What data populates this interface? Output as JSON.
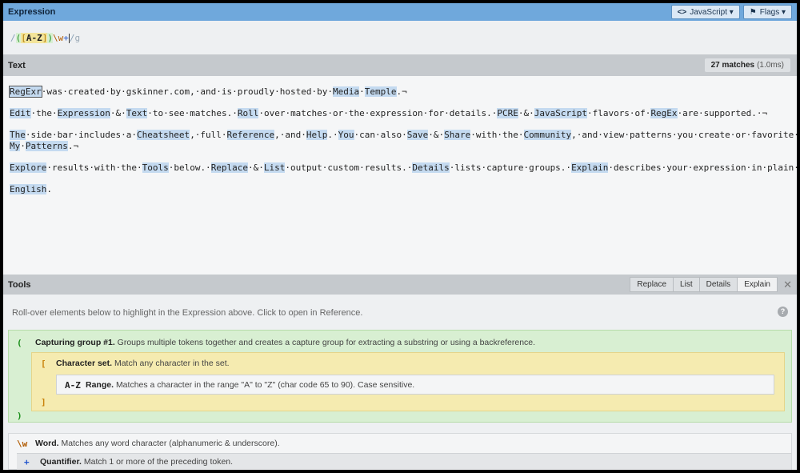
{
  "expression": {
    "title": "Expression",
    "flavor_button": "JavaScript ▾",
    "flavor_icon": "<>",
    "flags_button": "Flags ▾",
    "flags_icon": "⚑",
    "tokens": {
      "open_delim": "/",
      "group_open": "(",
      "set_open": "[",
      "range": "A-Z",
      "set_close": "]",
      "group_close": ")",
      "word": "\\w",
      "quant": "+",
      "close_delim": "/",
      "flags": "g"
    }
  },
  "text_panel": {
    "title": "Text",
    "match_count": "27 matches",
    "match_time": "(1.0ms)",
    "paragraphs": [
      [
        {
          "t": "RegExr",
          "m": true,
          "first": true
        },
        {
          "t": "·was·created·by·gskinner.com,·and·is·proudly·hosted·by·"
        },
        {
          "t": "Media",
          "m": true
        },
        {
          "t": "·"
        },
        {
          "t": "Temple",
          "m": true
        },
        {
          "t": ".¬"
        }
      ],
      [
        {
          "t": "Edit",
          "m": true
        },
        {
          "t": "·the·"
        },
        {
          "t": "Expression",
          "m": true
        },
        {
          "t": "·&·"
        },
        {
          "t": "Text",
          "m": true
        },
        {
          "t": "·to·see·matches.·"
        },
        {
          "t": "Roll",
          "m": true
        },
        {
          "t": "·over·matches·or·the·expression·for·details.·"
        },
        {
          "t": "PCRE",
          "m": true
        },
        {
          "t": "·&·"
        },
        {
          "t": "JavaScript",
          "m": true
        },
        {
          "t": "·flavors·of·"
        },
        {
          "t": "RegEx",
          "m": true
        },
        {
          "t": "·are·supported.·¬"
        }
      ],
      [
        {
          "t": "The",
          "m": true
        },
        {
          "t": "·side·bar·includes·a·"
        },
        {
          "t": "Cheatsheet",
          "m": true
        },
        {
          "t": ",·full·"
        },
        {
          "t": "Reference",
          "m": true
        },
        {
          "t": ",·and·"
        },
        {
          "t": "Help",
          "m": true
        },
        {
          "t": ".·"
        },
        {
          "t": "You",
          "m": true
        },
        {
          "t": "·can·also·"
        },
        {
          "t": "Save",
          "m": true
        },
        {
          "t": "·&·"
        },
        {
          "t": "Share",
          "m": true
        },
        {
          "t": "·with·the·"
        },
        {
          "t": "Community",
          "m": true
        },
        {
          "t": ",·and·view·patterns·you·create·or·favorite·in·"
        }
      ],
      [
        {
          "t": "My",
          "m": true
        },
        {
          "t": "·"
        },
        {
          "t": "Patterns",
          "m": true
        },
        {
          "t": ".¬"
        }
      ],
      [
        {
          "t": "Explore",
          "m": true
        },
        {
          "t": "·results·with·the·"
        },
        {
          "t": "Tools",
          "m": true
        },
        {
          "t": "·below.·"
        },
        {
          "t": "Replace",
          "m": true
        },
        {
          "t": "·&·"
        },
        {
          "t": "List",
          "m": true
        },
        {
          "t": "·output·custom·results.·"
        },
        {
          "t": "Details",
          "m": true
        },
        {
          "t": "·lists·capture·groups.·"
        },
        {
          "t": "Explain",
          "m": true
        },
        {
          "t": "·describes·your·expression·in·plain·"
        }
      ],
      [
        {
          "t": "English",
          "m": true
        },
        {
          "t": "."
        }
      ]
    ]
  },
  "tools": {
    "title": "Tools",
    "tabs": [
      "Replace",
      "List",
      "Details",
      "Explain"
    ],
    "active_tab": "Explain",
    "close": "✕",
    "hint": "Roll-over elements below to highlight in the Expression above. Click to open in Reference.",
    "help": "?",
    "explain": {
      "group_open_sym": "(",
      "group_label": "Capturing group #1.",
      "group_desc": "Groups multiple tokens together and creates a capture group for extracting a substring or using a backreference.",
      "group_close_sym": ")",
      "set_open_sym": "[",
      "set_label": "Character set.",
      "set_desc": "Match any character in the set.",
      "set_close_sym": "]",
      "range_sym": "A-Z",
      "range_label": "Range.",
      "range_desc": "Matches a character in the range \"A\" to \"Z\" (char code 65 to 90). Case sensitive.",
      "word_sym": "\\w",
      "word_label": "Word.",
      "word_desc": "Matches any word character (alphanumeric & underscore).",
      "quant_sym": "+",
      "quant_label": "Quantifier.",
      "quant_desc": "Match 1 or more of the preceding token."
    }
  },
  "colors": {
    "header_blue": "#6fa8dc",
    "match_highlight": "#c4daf0",
    "group_green": "#d8efd2",
    "set_yellow": "#f5ebb0"
  }
}
